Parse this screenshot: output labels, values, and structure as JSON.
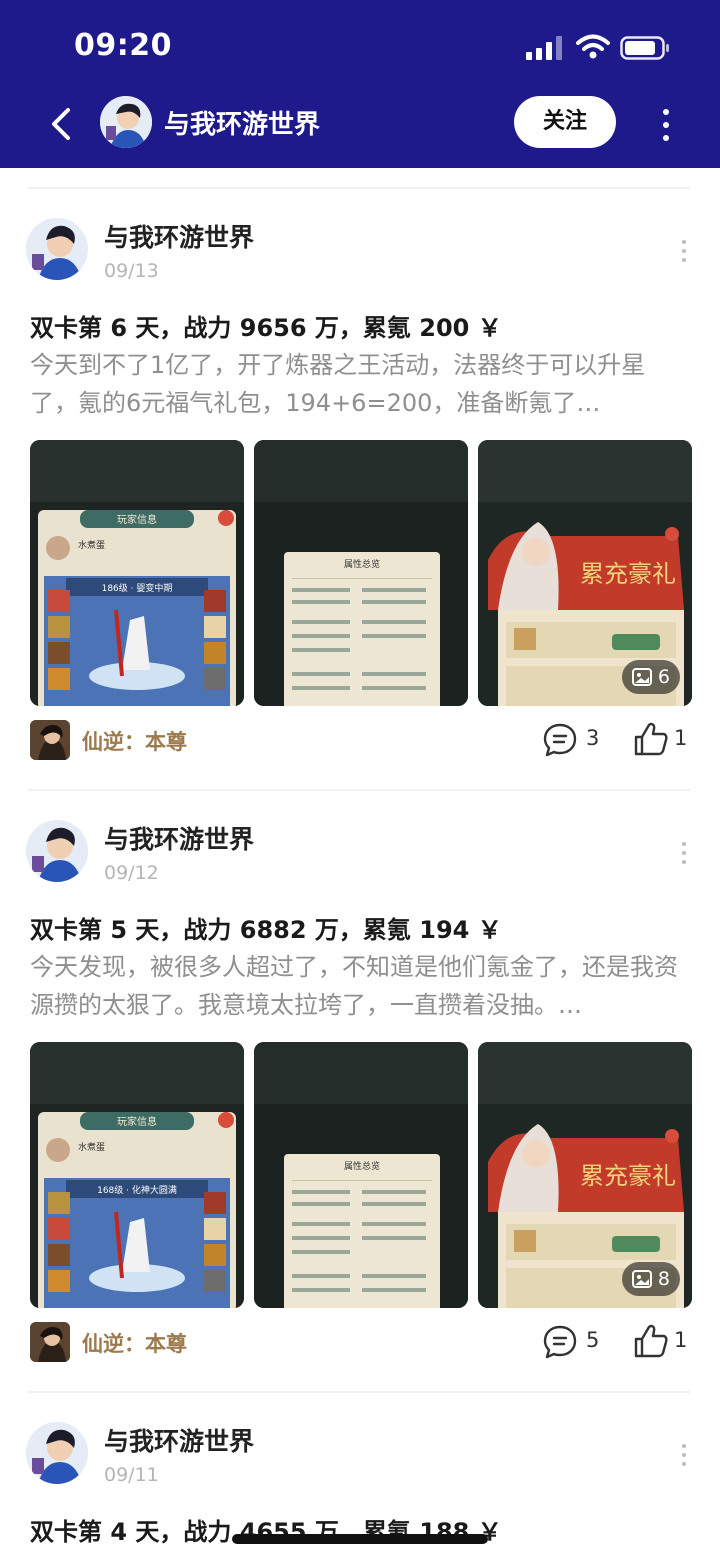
{
  "status_bar": {
    "time": "09:20"
  },
  "nav": {
    "title": "与我环游世界",
    "follow_label": "关注"
  },
  "posts": [
    {
      "author": "与我环游世界",
      "date": "09/13",
      "title": "双卡第 6 天，战力 9656 万，累氪 200 ￥",
      "body": "今天到不了1亿了，开了炼器之王活动，法器终于可以升星了，氪的6元福气礼包，194+6=200，准备断氪了…",
      "image_count": "6",
      "topic": "仙逆：本尊",
      "comments": "3",
      "likes": "1",
      "thumb_labels": [
        "玩家信息",
        "属性总览",
        "累充豪礼"
      ],
      "level_text": "186级 · 婴变中期",
      "player_name": "水煮蛋"
    },
    {
      "author": "与我环游世界",
      "date": "09/12",
      "title": "双卡第 5 天，战力 6882 万，累氪 194 ￥",
      "body": "今天发现，被很多人超过了，不知道是他们氪金了，还是我资源攒的太狠了。我意境太拉垮了，一直攒着没抽。…",
      "image_count": "8",
      "topic": "仙逆：本尊",
      "comments": "5",
      "likes": "1",
      "thumb_labels": [
        "玩家信息",
        "属性总览",
        "累充豪礼"
      ],
      "level_text": "168级 · 化神大圆满",
      "player_name": "水煮蛋"
    },
    {
      "author": "与我环游世界",
      "date": "09/11",
      "title": "双卡第 4 天，战力 4655 万，累氪 188 ￥",
      "body": "",
      "image_count": "",
      "topic": "",
      "comments": "",
      "likes": "",
      "thumb_labels": [],
      "level_text": "",
      "player_name": ""
    }
  ],
  "colors": {
    "header_bg": "#1e1a8c",
    "topic": "#9c7a4d",
    "muted": "#8f8f8f"
  }
}
